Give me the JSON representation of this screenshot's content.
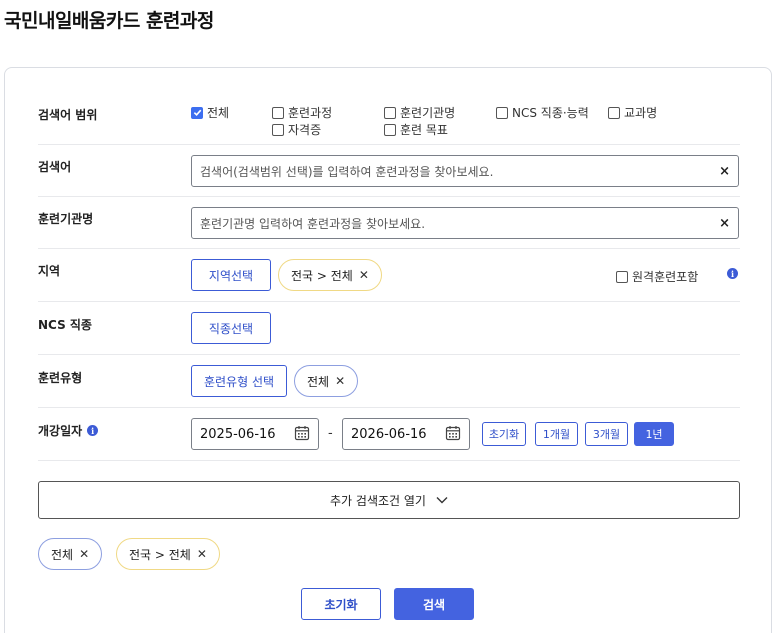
{
  "page": {
    "title": "국민내일배움카드 훈련과정"
  },
  "search_scope": {
    "label": "검색어 범위",
    "options": [
      {
        "label": "전체",
        "checked": true
      },
      {
        "label": "훈련과정",
        "checked": false
      },
      {
        "label": "훈련기관명",
        "checked": false
      },
      {
        "label": "NCS 직종·능력",
        "checked": false
      },
      {
        "label": "교과명",
        "checked": false
      },
      {
        "label": "자격증",
        "checked": false
      },
      {
        "label": "훈련 목표",
        "checked": false
      }
    ]
  },
  "keyword": {
    "label": "검색어",
    "placeholder": "검색어(검색범위 선택)를 입력하여 훈련과정을 찾아보세요.",
    "clear": "×"
  },
  "institution": {
    "label": "훈련기관명",
    "placeholder": "훈련기관명 입력하여 훈련과정을 찾아보세요.",
    "clear": "×"
  },
  "region": {
    "label": "지역",
    "select_button": "지역선택",
    "chip": "전국 > 전체",
    "remote_label": "원격훈련포함",
    "remote_checked": false
  },
  "ncs": {
    "label": "NCS 직종",
    "select_button": "직종선택"
  },
  "training_type": {
    "label": "훈련유형",
    "select_button": "훈련유형 선택",
    "chip": "전체"
  },
  "date": {
    "label": "개강일자",
    "start": "2025-06-16",
    "separator": "-",
    "end": "2026-06-16",
    "buttons": [
      {
        "label": "초기화",
        "active": false
      },
      {
        "label": "1개월",
        "active": false
      },
      {
        "label": "3개월",
        "active": false
      },
      {
        "label": "1년",
        "active": true
      }
    ]
  },
  "more_conditions": {
    "label": "추가 검색조건 열기"
  },
  "selected_chips": [
    "전체",
    "전국 > 전체"
  ],
  "actions": {
    "reset": "초기화",
    "search": "검색"
  },
  "colors": {
    "primary": "#4463e0",
    "chip_yellow": "#f0d985",
    "chip_blue": "#8d9fe0"
  }
}
